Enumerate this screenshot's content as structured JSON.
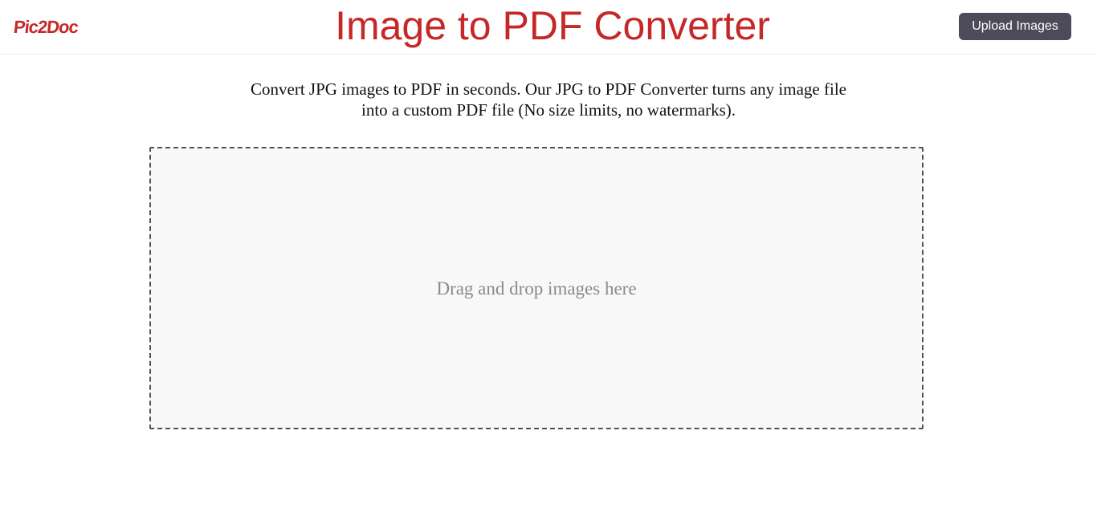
{
  "header": {
    "logo_text": "Pic2Doc",
    "title": "Image to PDF Converter",
    "upload_button_label": "Upload Images"
  },
  "intro": {
    "line1": "Convert JPG images to PDF in seconds. Our JPG to PDF Converter turns any image file",
    "line2": "into a custom PDF file (No size limits, no watermarks)."
  },
  "dropzone": {
    "prompt": "Drag and drop images here"
  },
  "colors": {
    "brand_red": "#c62828",
    "button_bg": "#4d4a5a",
    "dropzone_border": "#5a4d56",
    "dropzone_bg": "#f8f8f8"
  }
}
